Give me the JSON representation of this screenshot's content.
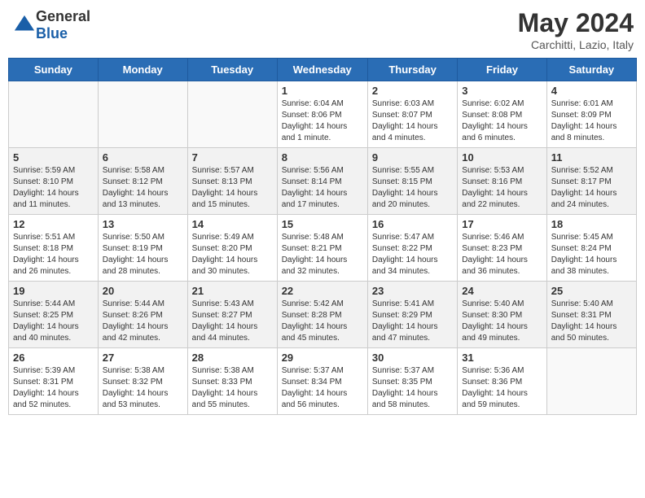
{
  "logo": {
    "general": "General",
    "blue": "Blue"
  },
  "title": {
    "month_year": "May 2024",
    "location": "Carchitti, Lazio, Italy"
  },
  "days_of_week": [
    "Sunday",
    "Monday",
    "Tuesday",
    "Wednesday",
    "Thursday",
    "Friday",
    "Saturday"
  ],
  "weeks": [
    [
      {
        "day": "",
        "info": ""
      },
      {
        "day": "",
        "info": ""
      },
      {
        "day": "",
        "info": ""
      },
      {
        "day": "1",
        "info": "Sunrise: 6:04 AM\nSunset: 8:06 PM\nDaylight: 14 hours\nand 1 minute."
      },
      {
        "day": "2",
        "info": "Sunrise: 6:03 AM\nSunset: 8:07 PM\nDaylight: 14 hours\nand 4 minutes."
      },
      {
        "day": "3",
        "info": "Sunrise: 6:02 AM\nSunset: 8:08 PM\nDaylight: 14 hours\nand 6 minutes."
      },
      {
        "day": "4",
        "info": "Sunrise: 6:01 AM\nSunset: 8:09 PM\nDaylight: 14 hours\nand 8 minutes."
      }
    ],
    [
      {
        "day": "5",
        "info": "Sunrise: 5:59 AM\nSunset: 8:10 PM\nDaylight: 14 hours\nand 11 minutes."
      },
      {
        "day": "6",
        "info": "Sunrise: 5:58 AM\nSunset: 8:12 PM\nDaylight: 14 hours\nand 13 minutes."
      },
      {
        "day": "7",
        "info": "Sunrise: 5:57 AM\nSunset: 8:13 PM\nDaylight: 14 hours\nand 15 minutes."
      },
      {
        "day": "8",
        "info": "Sunrise: 5:56 AM\nSunset: 8:14 PM\nDaylight: 14 hours\nand 17 minutes."
      },
      {
        "day": "9",
        "info": "Sunrise: 5:55 AM\nSunset: 8:15 PM\nDaylight: 14 hours\nand 20 minutes."
      },
      {
        "day": "10",
        "info": "Sunrise: 5:53 AM\nSunset: 8:16 PM\nDaylight: 14 hours\nand 22 minutes."
      },
      {
        "day": "11",
        "info": "Sunrise: 5:52 AM\nSunset: 8:17 PM\nDaylight: 14 hours\nand 24 minutes."
      }
    ],
    [
      {
        "day": "12",
        "info": "Sunrise: 5:51 AM\nSunset: 8:18 PM\nDaylight: 14 hours\nand 26 minutes."
      },
      {
        "day": "13",
        "info": "Sunrise: 5:50 AM\nSunset: 8:19 PM\nDaylight: 14 hours\nand 28 minutes."
      },
      {
        "day": "14",
        "info": "Sunrise: 5:49 AM\nSunset: 8:20 PM\nDaylight: 14 hours\nand 30 minutes."
      },
      {
        "day": "15",
        "info": "Sunrise: 5:48 AM\nSunset: 8:21 PM\nDaylight: 14 hours\nand 32 minutes."
      },
      {
        "day": "16",
        "info": "Sunrise: 5:47 AM\nSunset: 8:22 PM\nDaylight: 14 hours\nand 34 minutes."
      },
      {
        "day": "17",
        "info": "Sunrise: 5:46 AM\nSunset: 8:23 PM\nDaylight: 14 hours\nand 36 minutes."
      },
      {
        "day": "18",
        "info": "Sunrise: 5:45 AM\nSunset: 8:24 PM\nDaylight: 14 hours\nand 38 minutes."
      }
    ],
    [
      {
        "day": "19",
        "info": "Sunrise: 5:44 AM\nSunset: 8:25 PM\nDaylight: 14 hours\nand 40 minutes."
      },
      {
        "day": "20",
        "info": "Sunrise: 5:44 AM\nSunset: 8:26 PM\nDaylight: 14 hours\nand 42 minutes."
      },
      {
        "day": "21",
        "info": "Sunrise: 5:43 AM\nSunset: 8:27 PM\nDaylight: 14 hours\nand 44 minutes."
      },
      {
        "day": "22",
        "info": "Sunrise: 5:42 AM\nSunset: 8:28 PM\nDaylight: 14 hours\nand 45 minutes."
      },
      {
        "day": "23",
        "info": "Sunrise: 5:41 AM\nSunset: 8:29 PM\nDaylight: 14 hours\nand 47 minutes."
      },
      {
        "day": "24",
        "info": "Sunrise: 5:40 AM\nSunset: 8:30 PM\nDaylight: 14 hours\nand 49 minutes."
      },
      {
        "day": "25",
        "info": "Sunrise: 5:40 AM\nSunset: 8:31 PM\nDaylight: 14 hours\nand 50 minutes."
      }
    ],
    [
      {
        "day": "26",
        "info": "Sunrise: 5:39 AM\nSunset: 8:31 PM\nDaylight: 14 hours\nand 52 minutes."
      },
      {
        "day": "27",
        "info": "Sunrise: 5:38 AM\nSunset: 8:32 PM\nDaylight: 14 hours\nand 53 minutes."
      },
      {
        "day": "28",
        "info": "Sunrise: 5:38 AM\nSunset: 8:33 PM\nDaylight: 14 hours\nand 55 minutes."
      },
      {
        "day": "29",
        "info": "Sunrise: 5:37 AM\nSunset: 8:34 PM\nDaylight: 14 hours\nand 56 minutes."
      },
      {
        "day": "30",
        "info": "Sunrise: 5:37 AM\nSunset: 8:35 PM\nDaylight: 14 hours\nand 58 minutes."
      },
      {
        "day": "31",
        "info": "Sunrise: 5:36 AM\nSunset: 8:36 PM\nDaylight: 14 hours\nand 59 minutes."
      },
      {
        "day": "",
        "info": ""
      }
    ]
  ]
}
